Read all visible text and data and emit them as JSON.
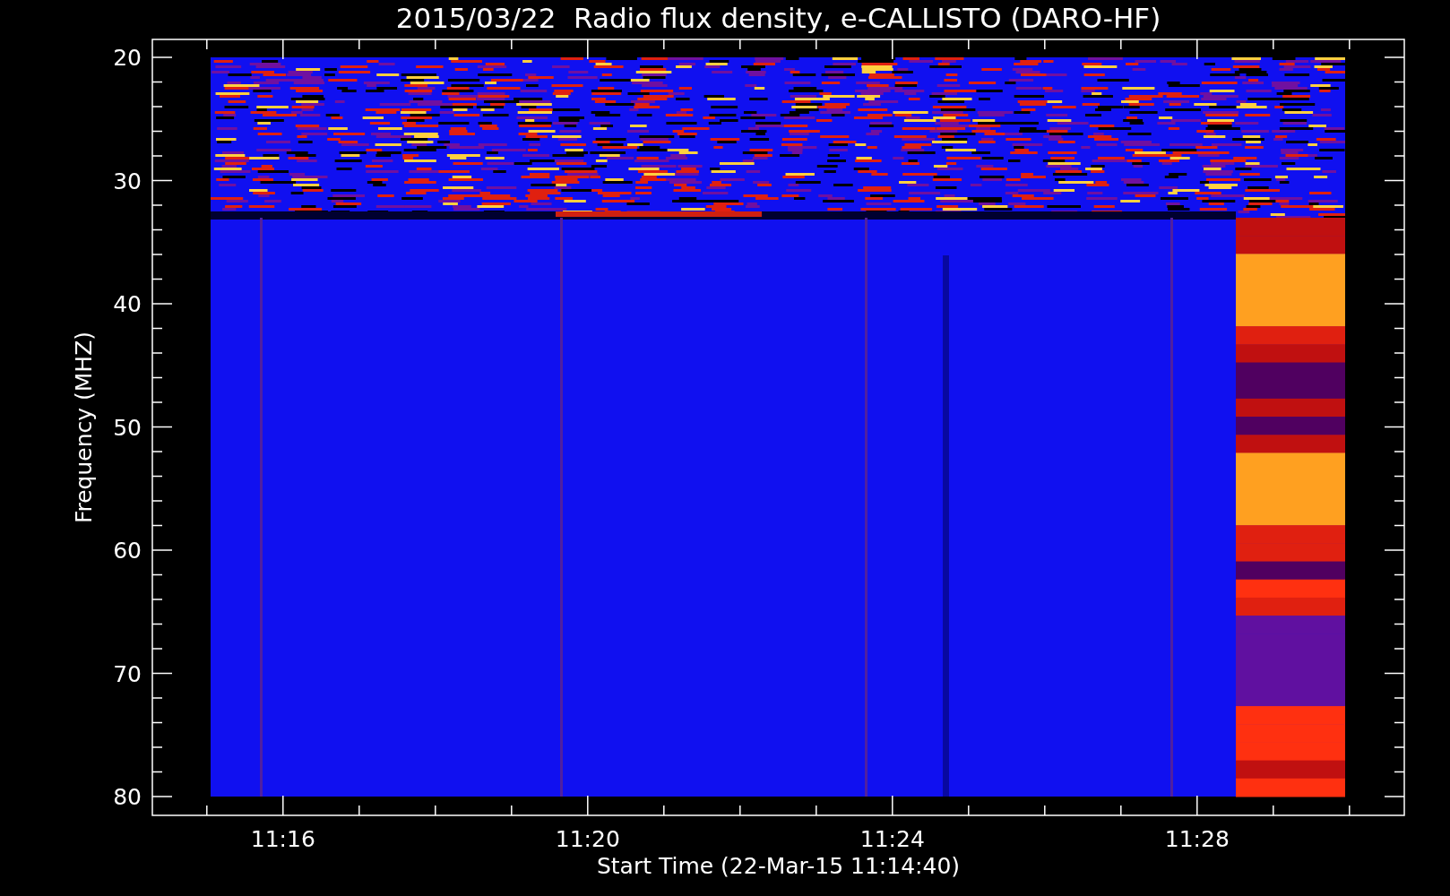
{
  "title": "2015/03/22  Radio flux density, e-CALLISTO (DARO-HF)",
  "plot": {
    "ylabel": "Frequency (MHZ)",
    "xlabel": "Start Time (22-Mar-15 11:14:40)",
    "yticks": [
      "20",
      "30",
      "40",
      "50",
      "60",
      "70",
      "80"
    ],
    "xticks": [
      "11:16",
      "11:20",
      "11:24",
      "11:28"
    ]
  }
}
